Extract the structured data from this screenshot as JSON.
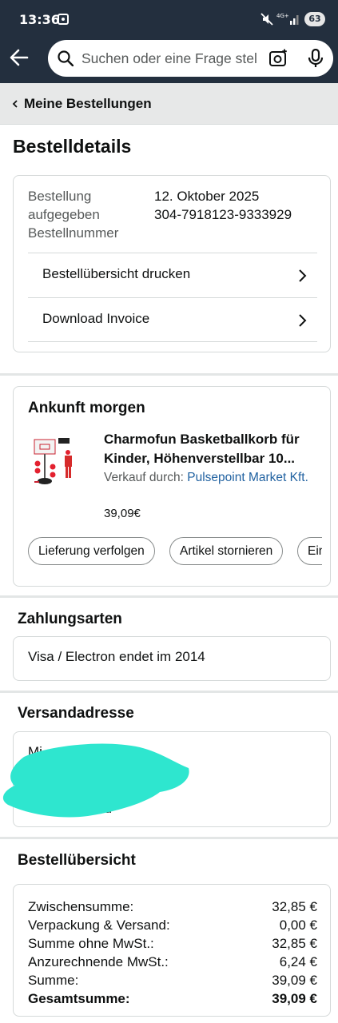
{
  "status_bar": {
    "time": "13:36",
    "network": "4G+",
    "battery": "63"
  },
  "header": {
    "search_placeholder": "Suchen oder eine Frage stellen"
  },
  "breadcrumb": {
    "label": "Meine Bestellungen"
  },
  "page": {
    "title": "Bestelldetails"
  },
  "order_info": {
    "label": "Bestellung aufgegeben Bestellnummer",
    "date": "12. Oktober 2025",
    "order_number": "304-7918123-9333929",
    "actions": [
      {
        "label": "Bestellübersicht drucken"
      },
      {
        "label": "Download Invoice"
      }
    ]
  },
  "shipment": {
    "title": "Ankunft morgen",
    "product_name": "Charmofun Basketballkorb für Kinder, Höhenverstellbar 10...",
    "seller_prefix": "Verkauf durch: ",
    "seller_name": "Pulsepoint Market Kft.",
    "price": "39,09€",
    "buttons": [
      {
        "label": "Lieferung verfolgen"
      },
      {
        "label": "Artikel stornieren"
      },
      {
        "label": "Ein"
      }
    ]
  },
  "payment": {
    "heading": "Zahlungsarten",
    "method": "Visa / Electron endet im 2014"
  },
  "shipping_address": {
    "heading": "Versandadresse",
    "line_1": "Mi",
    "line_3": "nd"
  },
  "order_summary": {
    "heading": "Bestellübersicht",
    "rows": [
      {
        "label": "Zwischensumme:",
        "value": "32,85 €"
      },
      {
        "label": "Verpackung & Versand:",
        "value": "0,00 €"
      },
      {
        "label": "Summe ohne MwSt.:",
        "value": "32,85 €"
      },
      {
        "label": "Anzurechnende MwSt.:",
        "value": "6,24 €"
      },
      {
        "label": "Summe:",
        "value": "39,09 €"
      }
    ],
    "total": {
      "label": "Gesamtsumme:",
      "value": "39,09 €"
    }
  },
  "colors": {
    "header_bg": "#232f3e",
    "link": "#2162a1",
    "redaction": "#2ee6cf"
  }
}
